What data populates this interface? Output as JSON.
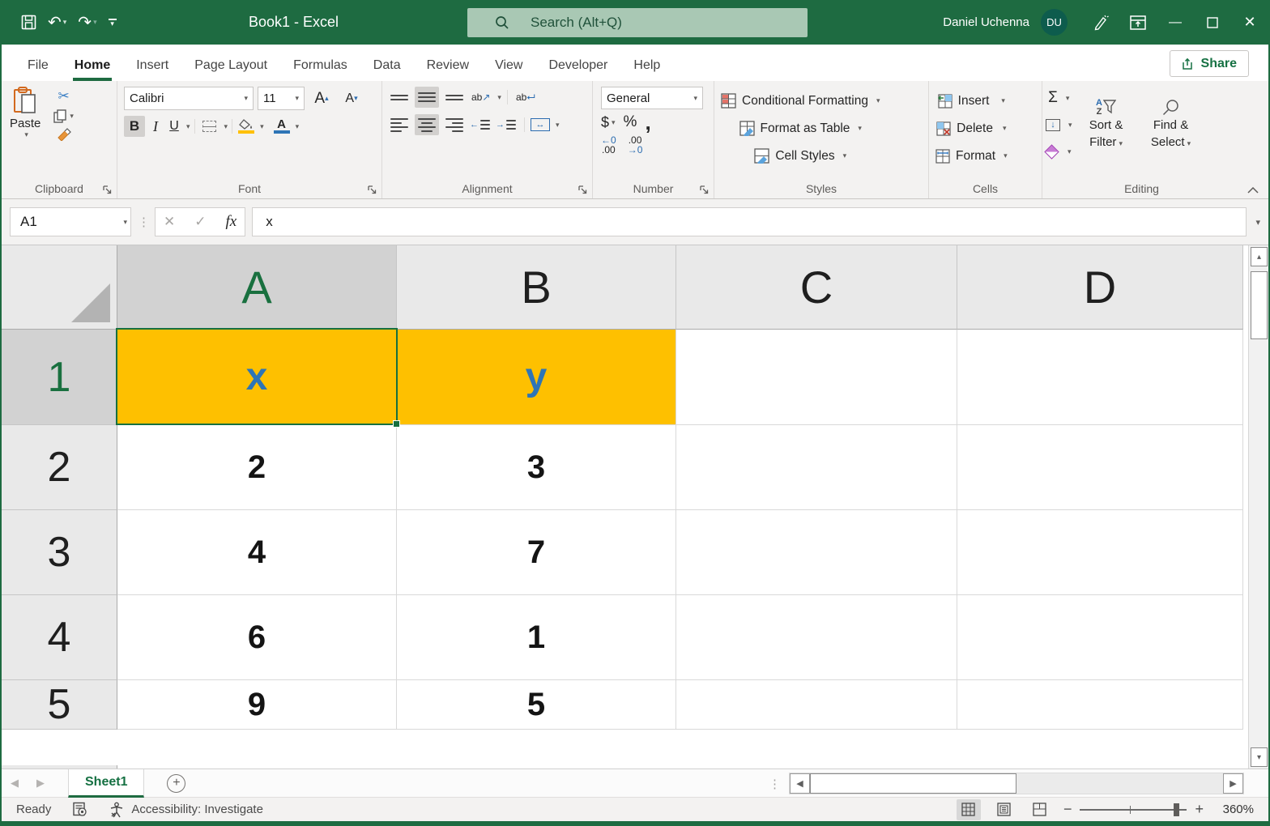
{
  "colors": {
    "accent_green": "#1e6b41",
    "titlebar_green": "#1e6b41",
    "search_box_green": "#a9c8b4",
    "highlight_cell_fill": "#FEC000",
    "highlight_cell_text": "#2E75B6",
    "selected_header_bg": "#D2D2D2"
  },
  "titlebar": {
    "title": "Book1  -  Excel",
    "search_placeholder": "Search (Alt+Q)",
    "user_name": "Daniel Uchenna",
    "user_initials": "DU"
  },
  "tabs": {
    "items": [
      "File",
      "Home",
      "Insert",
      "Page Layout",
      "Formulas",
      "Data",
      "Review",
      "View",
      "Developer",
      "Help"
    ],
    "active": "Home",
    "share_label": "Share"
  },
  "ribbon": {
    "clipboard": {
      "label": "Clipboard",
      "paste": "Paste"
    },
    "font": {
      "label": "Font",
      "family": "Calibri",
      "size": "11",
      "bold": "B",
      "italic": "I",
      "underline": "U"
    },
    "alignment": {
      "label": "Alignment",
      "orientation_glyph": "ab",
      "wrap_glyph": "ab"
    },
    "number": {
      "label": "Number",
      "format": "General",
      "currency": "$",
      "percent": "%",
      "comma": ",",
      "inc_dec_top": "←0",
      "inc_dec_bottom": ".00",
      "dec_dec_top": ".00",
      "dec_dec_bottom": "→0"
    },
    "styles": {
      "label": "Styles",
      "conditional": "Conditional Formatting",
      "format_table": "Format as Table",
      "cell_styles": "Cell Styles"
    },
    "cells": {
      "label": "Cells",
      "insert": "Insert",
      "delete": "Delete",
      "format": "Format"
    },
    "editing": {
      "label": "Editing",
      "autosum_glyph": "Σ",
      "sort_line1": "Sort &",
      "sort_line2": "Filter",
      "find_line1": "Find &",
      "find_line2": "Select"
    }
  },
  "formula_bar": {
    "name_box": "A1",
    "cancel_glyph": "✕",
    "enter_glyph": "✓",
    "fx_label": "fx",
    "content": "x"
  },
  "sheet": {
    "columns": [
      "A",
      "B",
      "C",
      "D"
    ],
    "active_cell": "A1",
    "rows": [
      {
        "n": "1",
        "a": "x",
        "b": "y",
        "c": "",
        "d": ""
      },
      {
        "n": "2",
        "a": "2",
        "b": "3",
        "c": "",
        "d": ""
      },
      {
        "n": "3",
        "a": "4",
        "b": "7",
        "c": "",
        "d": ""
      },
      {
        "n": "4",
        "a": "6",
        "b": "1",
        "c": "",
        "d": ""
      },
      {
        "n": "5",
        "a": "9",
        "b": "5",
        "c": "",
        "d": ""
      }
    ]
  },
  "sheet_tabs": {
    "active": "Sheet1",
    "add_glyph": "+"
  },
  "status_bar": {
    "mode": "Ready",
    "accessibility_label": "Accessibility: Investigate",
    "zoom_level": "360%"
  },
  "icons": {
    "undo": "↶",
    "redo": "↷",
    "scissors": "✂",
    "dropdown": "▾",
    "left_arrow": "◂",
    "right_arrow": "▸",
    "up_arrow": "▴",
    "down_arrow": "▾"
  }
}
